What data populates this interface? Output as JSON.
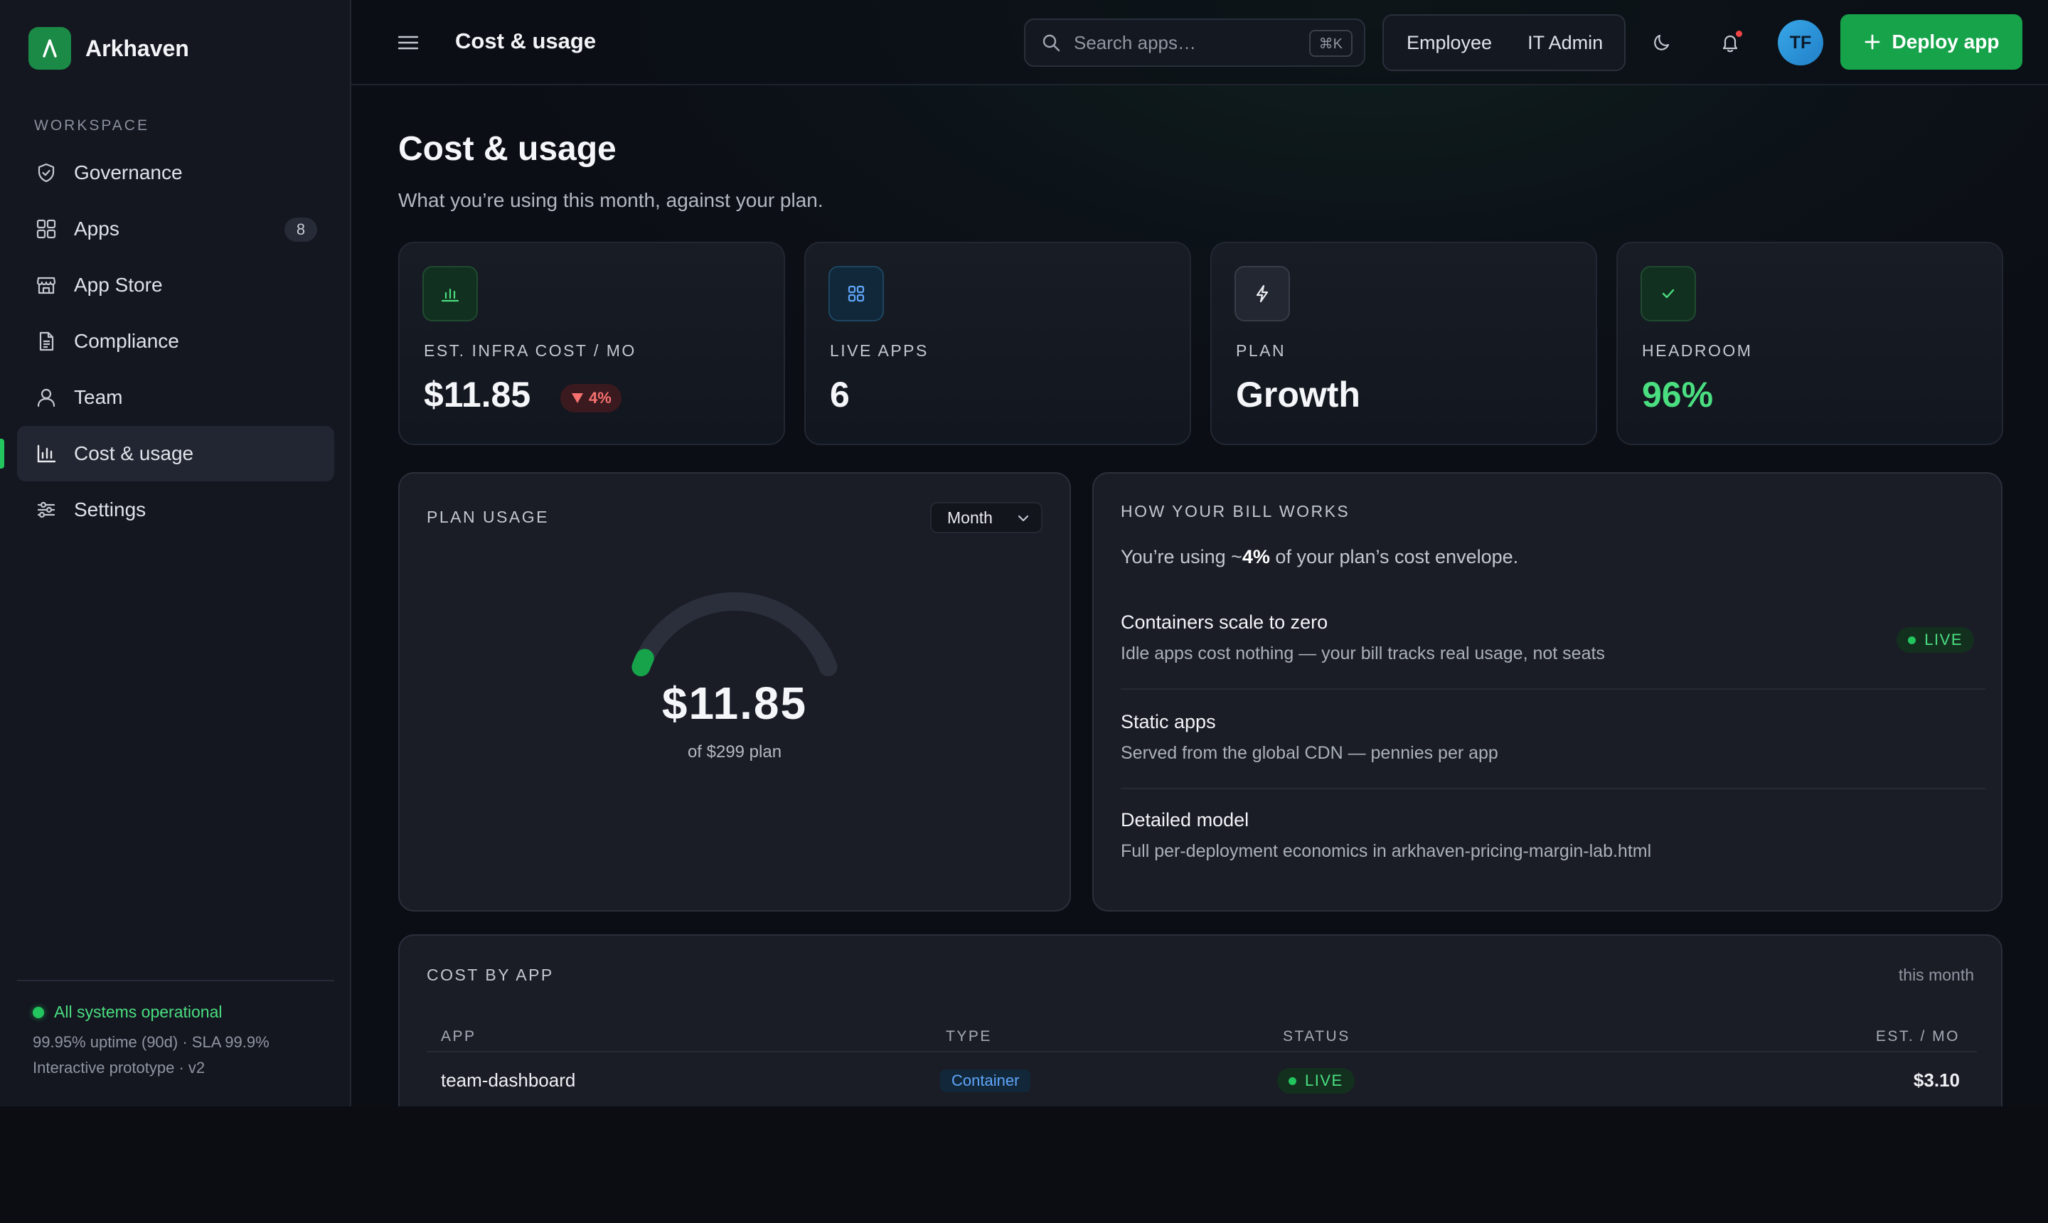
{
  "brand": {
    "name": "Arkhaven",
    "logo_letter": "A"
  },
  "sidebar": {
    "section_label": "WORKSPACE",
    "items": [
      {
        "label": "Governance",
        "icon": "shield-check-icon"
      },
      {
        "label": "Apps",
        "icon": "grid-icon",
        "badge": "8"
      },
      {
        "label": "App Store",
        "icon": "store-icon"
      },
      {
        "label": "Compliance",
        "icon": "document-icon"
      },
      {
        "label": "Team",
        "icon": "user-icon"
      },
      {
        "label": "Cost & usage",
        "icon": "bar-chart-icon",
        "active": true
      },
      {
        "label": "Settings",
        "icon": "sliders-icon"
      }
    ],
    "footer": {
      "status": "All systems operational",
      "uptime": "99.95% uptime (90d) · SLA 99.9%",
      "note": "Interactive prototype · v2"
    }
  },
  "topbar": {
    "title": "Cost & usage",
    "search": {
      "placeholder": "Search apps…",
      "value": "",
      "shortcut": "⌘K"
    },
    "roles": [
      "Employee",
      "IT Admin"
    ],
    "avatar_initials": "TF",
    "deploy_label": "Deploy app"
  },
  "page": {
    "title": "Cost & usage",
    "subtitle": "What you’re using this month, against your plan."
  },
  "kpis": [
    {
      "label": "EST. INFRA COST / MO",
      "value": "$11.85",
      "delta": "4%",
      "icon": "bar-chart-icon"
    },
    {
      "label": "LIVE APPS",
      "value": "6",
      "icon": "grid-icon"
    },
    {
      "label": "PLAN",
      "value": "Growth",
      "icon": "bolt-icon"
    },
    {
      "label": "HEADROOM",
      "value": "96%",
      "icon": "check-icon"
    }
  ],
  "plan_usage": {
    "label": "PLAN USAGE",
    "period": "Month",
    "value": "$11.85",
    "sub": "of $299 plan",
    "fraction": 0.04
  },
  "bill": {
    "label": "HOW YOUR BILL WORKS",
    "intro_prefix": "You’re using ~",
    "intro_pct": "4%",
    "intro_suffix": " of your plan’s cost envelope.",
    "items": [
      {
        "title": "Containers scale to zero",
        "desc": "Idle apps cost nothing — your bill tracks real usage, not seats",
        "badge": "LIVE"
      },
      {
        "title": "Static apps",
        "desc": "Served from the global CDN — pennies per app"
      },
      {
        "title": "Detailed model",
        "desc": "Full per-deployment economics in arkhaven-pricing-margin-lab.html"
      }
    ]
  },
  "cost_by_app": {
    "label": "COST BY APP",
    "period": "this month",
    "columns": [
      "APP",
      "TYPE",
      "STATUS",
      "EST. / MO"
    ],
    "rows": [
      {
        "app": "team-dashboard",
        "type": "Container",
        "status": "LIVE",
        "cost": "$3.10"
      }
    ]
  },
  "colors": {
    "accent": "#16a34a",
    "live": "#22c55e",
    "danger": "#f87171",
    "sidebar": "#141720",
    "panel": "#1a1d26"
  }
}
